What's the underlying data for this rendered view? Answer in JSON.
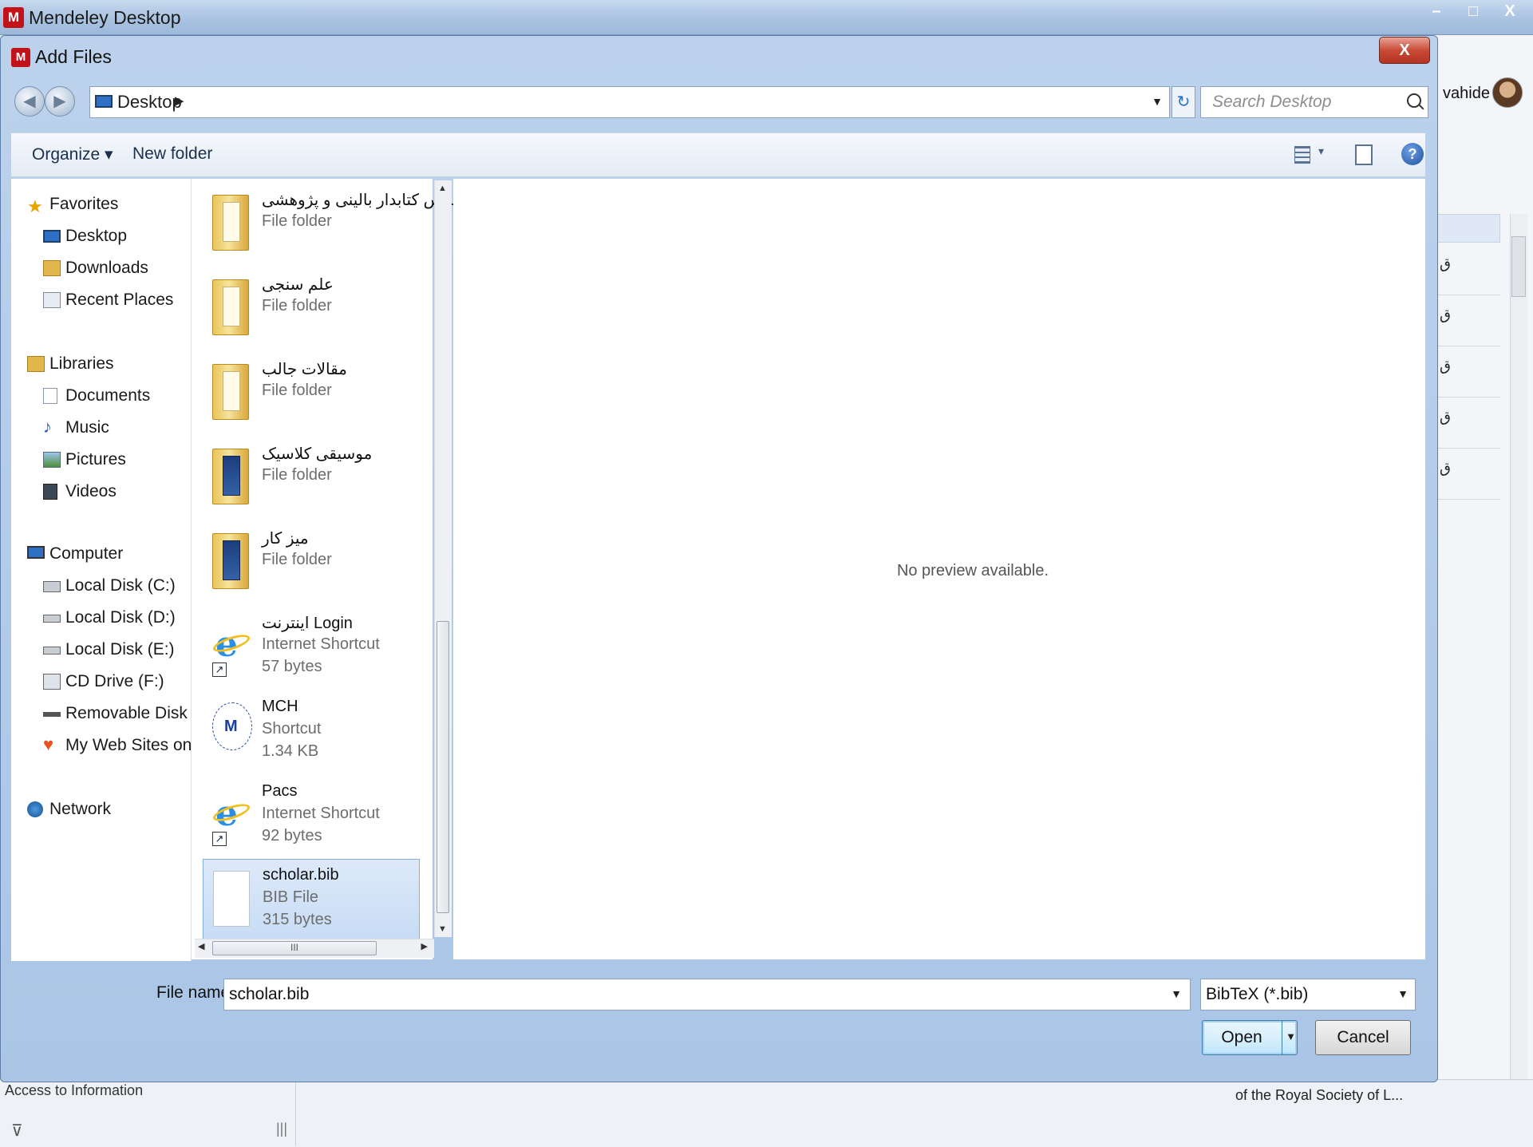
{
  "app": {
    "title": "Mendeley Desktop",
    "logo": "M",
    "window_controls": [
      "–",
      "□",
      "X"
    ],
    "user_name": "vahide",
    "list_rows": [
      "ق",
      "ق",
      "ق",
      "ق",
      "ق"
    ],
    "bottom_left_label": "Access to Information",
    "bottom_right_label": "of the Royal Society of L...",
    "bottom_filter_icon": "filter-icon",
    "bottom_splitter": "|||"
  },
  "dialog": {
    "title": "Add Files",
    "logo": "M",
    "close_label": "X",
    "address": {
      "crumb": "Desktop",
      "crumb_arrow": "▶",
      "drop": "▼"
    },
    "refresh_icon": "↻",
    "search_placeholder": "Search Desktop",
    "toolbar": {
      "organize": "Organize ▾",
      "new_folder": "New folder",
      "views_arrow": "▾",
      "help": "?"
    },
    "nav": {
      "favorites": "Favorites",
      "desktop": "Desktop",
      "downloads": "Downloads",
      "recent_places": "Recent Places",
      "libraries": "Libraries",
      "documents": "Documents",
      "music": "Music",
      "pictures": "Pictures",
      "videos": "Videos",
      "computer": "Computer",
      "local_c": "Local Disk (C:)",
      "local_d": "Local Disk (D:)",
      "local_e": "Local Disk (E:)",
      "cd_drive": "CD Drive (F:)",
      "removable": "Removable Disk (G:)",
      "web_sites": "My Web Sites on MS",
      "network": "Network"
    },
    "files": [
      {
        "name": "ج درس کتابدار بالینی و پژوهشی",
        "type": "File folder",
        "size": ""
      },
      {
        "name": "علم سنجی",
        "type": "File folder",
        "size": ""
      },
      {
        "name": "مقالات جالب",
        "type": "File folder",
        "size": ""
      },
      {
        "name": "موسیقی کلاسیک",
        "type": "File folder",
        "size": ""
      },
      {
        "name": "میز کار",
        "type": "File folder",
        "size": ""
      },
      {
        "name": "اینترنت Login",
        "type": "Internet Shortcut",
        "size": "57 bytes"
      },
      {
        "name": "MCH",
        "type": "Shortcut",
        "size": "1.34 KB"
      },
      {
        "name": "Pacs",
        "type": "Internet Shortcut",
        "size": "92 bytes"
      },
      {
        "name": "scholar.bib",
        "type": "BIB File",
        "size": "315 bytes"
      }
    ],
    "scroll": {
      "up": "▲",
      "down": "▼",
      "left": "◀",
      "right": "▶",
      "grip": "III"
    },
    "preview_message": "No preview available.",
    "file_name_label": "File name:",
    "file_name_value": "scholar.bib",
    "file_type": "BibTeX (*.bib)",
    "drop_arrow": "▼",
    "open_label": "Open",
    "cancel_label": "Cancel"
  }
}
